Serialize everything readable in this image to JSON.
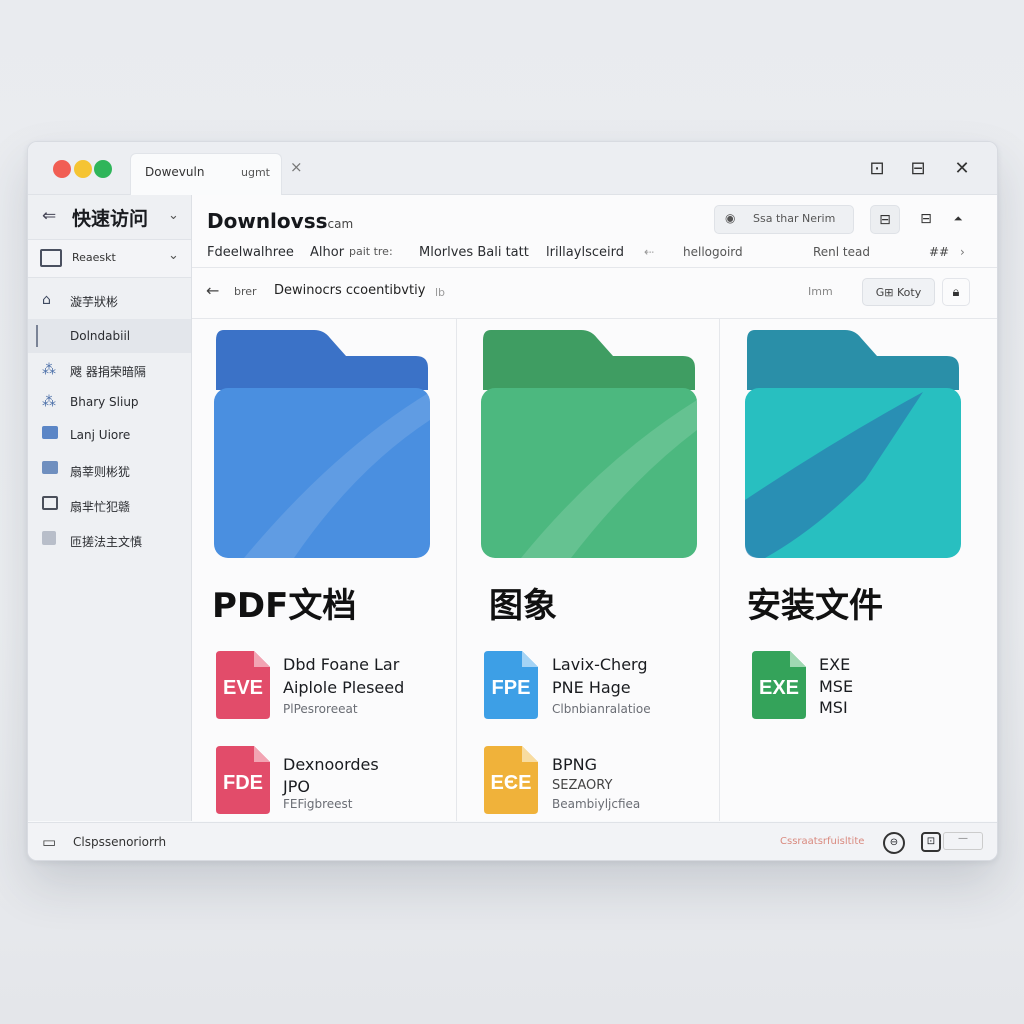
{
  "window": {
    "tab_title": "Dowevuln",
    "tab_subtitle": "ugmt",
    "tab_close": "×",
    "traffic_lights": {
      "close": "#f15e54",
      "minimize": "#f5c433",
      "maximize": "#2fb55a"
    },
    "controls": {
      "restore": "⊡",
      "dock": "⊟",
      "close": "✕"
    }
  },
  "sidebar": {
    "header": {
      "icon": "⇐",
      "title": "快速访问",
      "chevron": "⌄"
    },
    "section": {
      "label": "Reaeskt",
      "chevron": "⌄"
    },
    "items": [
      {
        "icon": "⌂",
        "label": "漩芋狀彬"
      },
      {
        "icon": "▏",
        "label": "Dolndabiil"
      },
      {
        "icon": "⁂",
        "label": "飕 器捐荣暗隔"
      },
      {
        "icon": "⁂",
        "label": "Bhary Sliup"
      },
      {
        "icon": "▣",
        "label": "Lanj Uiore"
      },
      {
        "icon": "▤",
        "label": "扇莘则彬犹"
      },
      {
        "icon": "▭",
        "label": "扇芈忙犯赣"
      },
      {
        "icon": "▯",
        "label": "匝搓法主文慎"
      }
    ]
  },
  "main": {
    "title": "Downlovss",
    "title_suffix": "cam",
    "search_placeholder": "Ssa thar Nerim",
    "columns": [
      "Fdeelwalhree",
      "Alhor",
      "pait tre:",
      "Mlorlves Bali tatt",
      "lrillaylsceird",
      "⇠",
      "hellogoird",
      "Renl tead",
      "##",
      "›"
    ],
    "address": {
      "back": "←",
      "crumb1": "brer",
      "crumb2": "Dewinocrs ccoentibvtiy",
      "crumb3": "lb",
      "crumb4": "Imm"
    },
    "sort_label": "G⊞ Koty",
    "categories": [
      {
        "label": "PDF文档",
        "folder_color": "#4a8fe0",
        "files": [
          {
            "ext": "EVE",
            "color": "#e24c6a",
            "line1": "Dbd Foane Lar",
            "line2": "Aiplole Pleseed",
            "line3": "PlPesroreeat"
          },
          {
            "ext": "FDE",
            "color": "#e24c6a",
            "line1": "Dexnoordes",
            "line2": "JPO",
            "line3": "FEFigbreest"
          }
        ]
      },
      {
        "label": "图象",
        "folder_color": "#4cb87f",
        "files": [
          {
            "ext": "FPE",
            "color": "#3d9fe6",
            "line1": "Lavix-Cherg",
            "line2": "PNE Hage",
            "line3": "Clbnbianralatioe"
          },
          {
            "ext": "EЄE",
            "color": "#f0b23a",
            "line1": "BPNG",
            "line2": "SEZAORY",
            "line3": "Beambiyljcfiea"
          }
        ]
      },
      {
        "label": "安装文件",
        "folder_color": "#28bfc0",
        "files": [
          {
            "ext": "EXE",
            "color": "#34a35a",
            "line1": "EXE",
            "line2": "MSE",
            "line3": "MSI"
          }
        ]
      }
    ]
  },
  "statusbar": {
    "label": "Clspssenoriorrh",
    "right_text": "Cssraatsrfuisltite",
    "btn1": "⊖",
    "btn2": "⊡",
    "btn3": "—"
  }
}
